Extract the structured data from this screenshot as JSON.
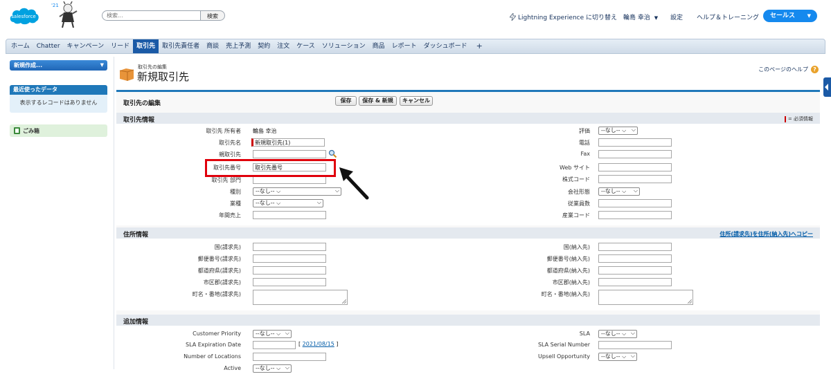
{
  "header": {
    "logo_text": "salesforce",
    "logo_badge": "'21",
    "search_placeholder": "検索...",
    "search_button": "検索",
    "lightning_switch": "Lightning Experience に切り替え",
    "user_name": "輪島 幸治",
    "setup": "設定",
    "help_training": "ヘルプ＆トレーニング",
    "app_name": "セールス"
  },
  "tabs": [
    {
      "label": "ホーム"
    },
    {
      "label": "Chatter"
    },
    {
      "label": "キャンペーン"
    },
    {
      "label": "リード"
    },
    {
      "label": "取引先",
      "active": true
    },
    {
      "label": "取引先責任者"
    },
    {
      "label": "商談"
    },
    {
      "label": "売上予測"
    },
    {
      "label": "契約"
    },
    {
      "label": "注文"
    },
    {
      "label": "ケース"
    },
    {
      "label": "ソリューション"
    },
    {
      "label": "商品"
    },
    {
      "label": "レポート"
    },
    {
      "label": "ダッシュボード"
    },
    {
      "label": "+"
    }
  ],
  "sidebar": {
    "create_new": "新規作成...",
    "recent_title": "最近使ったデータ",
    "recent_empty": "表示するレコードはありません",
    "recycle_bin": "ごみ箱"
  },
  "page": {
    "type_label": "取引先の編集",
    "title": "新規取引先",
    "help_link": "このページのヘルプ"
  },
  "form": {
    "edit_title": "取引先の編集",
    "save": "保存",
    "save_new": "保存 & 新規",
    "cancel": "キャンセル",
    "required_note": "= 必須情報",
    "sections": {
      "account_info": {
        "title": "取引先情報",
        "owner_label": "取引先 所有者",
        "owner_value": "輪島 幸治",
        "name_label": "取引先名",
        "name_value": "新規取引先(1)",
        "parent_label": "親取引先",
        "number_label": "取引先番号",
        "number_value": "取引先番号",
        "site_label": "取引先 部門",
        "type_label": "種別",
        "type_value": "--なし--",
        "industry_label": "業種",
        "industry_value": "--なし--",
        "revenue_label": "年間売上",
        "rating_label": "評価",
        "rating_value": "--なし--",
        "phone_label": "電話",
        "fax_label": "Fax",
        "website_label": "Web サイト",
        "ticker_label": "株式コード",
        "ownership_label": "会社形態",
        "ownership_value": "--なし--",
        "employees_label": "従業員数",
        "sic_label": "産業コード"
      },
      "address_info": {
        "title": "住所情報",
        "copy_link": "住所(請求先)を住所(納入先)へコピー",
        "billing_country": "国(請求先)",
        "billing_zip": "郵便番号(請求先)",
        "billing_state": "都道府県(請求先)",
        "billing_city": "市区郡(請求先)",
        "billing_street": "町名・番地(請求先)",
        "shipping_country": "国(納入先)",
        "shipping_zip": "郵便番号(納入先)",
        "shipping_state": "都道府県(納入先)",
        "shipping_city": "市区郡(納入先)",
        "shipping_street": "町名・番地(納入先)"
      },
      "additional_info": {
        "title": "追加情報",
        "priority_label": "Customer Priority",
        "priority_value": "--なし--",
        "sla_exp_label": "SLA Expiration Date",
        "sla_exp_hint": "2021/08/15",
        "locations_label": "Number of Locations",
        "active_label": "Active",
        "active_value": "--なし--",
        "sla_label": "SLA",
        "sla_value": "--なし--",
        "sla_serial_label": "SLA Serial Number",
        "upsell_label": "Upsell Opportunity",
        "upsell_value": "--なし--"
      }
    }
  },
  "colors": {
    "brand_blue": "#1589ee",
    "active_tab": "#1b5aa6",
    "highlight_red": "#e0000b",
    "required_red": "#cc0000"
  }
}
